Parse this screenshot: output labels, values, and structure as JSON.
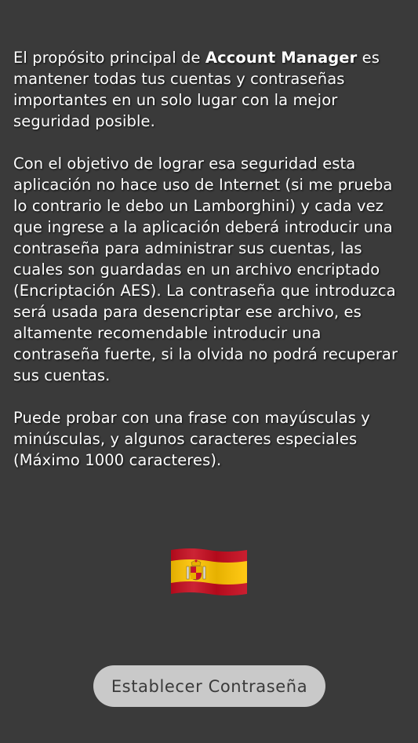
{
  "intro": {
    "p1_before": "El propósito principal de ",
    "app_name": "Account Manager",
    "p1_after": " es mantener todas tus cuentas y contraseñas importantes en un solo lugar con la mejor seguridad posible.",
    "p2": "Con el objetivo de lograr esa seguridad esta aplicación no hace uso de Internet (si me prueba lo contrario le debo un Lamborghini) y cada vez que ingrese a la aplicación deberá introducir una contraseña para administrar sus cuentas, las cuales son guardadas en un archivo encriptado (Encriptación AES). La contraseña que introduzca será usada para desencriptar ese archivo, es altamente recomendable introducir una contraseña fuerte, si la olvida no podrá recuperar sus cuentas.",
    "p3": "Puede probar con una frase con mayúsculas y minúsculas, y algunos caracteres especiales (Máximo 1000 caracteres)."
  },
  "language_flag": {
    "icon": "spain-flag-icon",
    "colors": {
      "red": "#c60b1e",
      "yellow": "#ffc400"
    }
  },
  "actions": {
    "set_password_label": "Establecer Contraseña"
  },
  "theme": {
    "background": "#3a3a3a",
    "text": "#ffffff",
    "button_bg": "#c9c9c9",
    "button_text": "#3a3a3a"
  }
}
